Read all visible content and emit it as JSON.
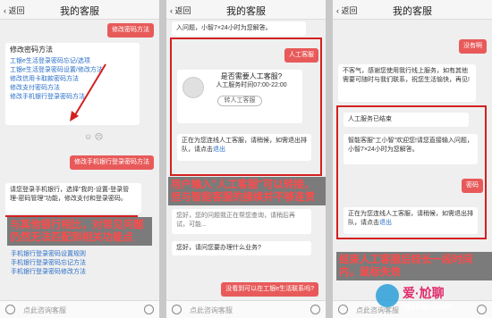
{
  "header": {
    "back_label": "返回",
    "title": "我的客服"
  },
  "input_placeholder": "点此咨询客服",
  "panel1": {
    "red_top": "修改密码方法",
    "card_title": "修改密码方法",
    "links": [
      "工银e生活登录密码忘记/选项",
      "工银e生活登录密码设置/修改方法",
      "修改信用卡取款密码方法",
      "修改支付密码方法",
      "修改手机银行登录密码方法"
    ],
    "red_mid": "修改手机银行登录密码方法",
    "answer": "请您登录手机银行，选择\"我的-设置-登录管理-密码管理\"功能，修改支付和登录密码。",
    "annotation": "与其他银行相比，对常见问题仍然无法匹配到相关功能点",
    "more_links": [
      "手机银行登录密码设置规则",
      "手机银行登录密码忘记方法",
      "手机银行登录密码修改方法"
    ]
  },
  "panel2": {
    "top_text": "入问题，小智7×24小时为您解答。",
    "red_btn": "人工客服",
    "prompt_q": "是否需要人工客服?",
    "prompt_time": "人工服务时间07:00-22:00",
    "prompt_btn": "转人工客服",
    "queue_text": "正在为您连线人工客服，请稍候，如需退出排队，请点击",
    "queue_link": "退出",
    "annotation": "用户输入\"人工客服\"可以转接，但与智能客服的接续并不够连贯",
    "echo1": "您好，您的问题我正在帮您查询，请稍后再试，可能...",
    "echo2": "您好，请问您要办理什么业务?",
    "red_bottom": "没看到可以在工银e生活联系吗?"
  },
  "panel3": {
    "red_top": "没有啊",
    "card_text": "不客气，感谢您使用我行线上服务，如有其他需要可随时与我们联系，祝您生活愉快，再见!",
    "ended": "人工服务已结束",
    "welcome": "智能客服\"工小智\"欢迎您!请您直接输入问题，小智7×24小时为您解答。",
    "red_mid": "密码",
    "queue_text": "正在为您连线人工客服，请稍候，如需退出排队，请点击",
    "queue_link": "退出",
    "annotation": "结束人工客服后较长一段时间内，鼠标失效"
  },
  "watermark": {
    "brand": "爱·尬聊",
    "domain": "igaliao.com"
  }
}
